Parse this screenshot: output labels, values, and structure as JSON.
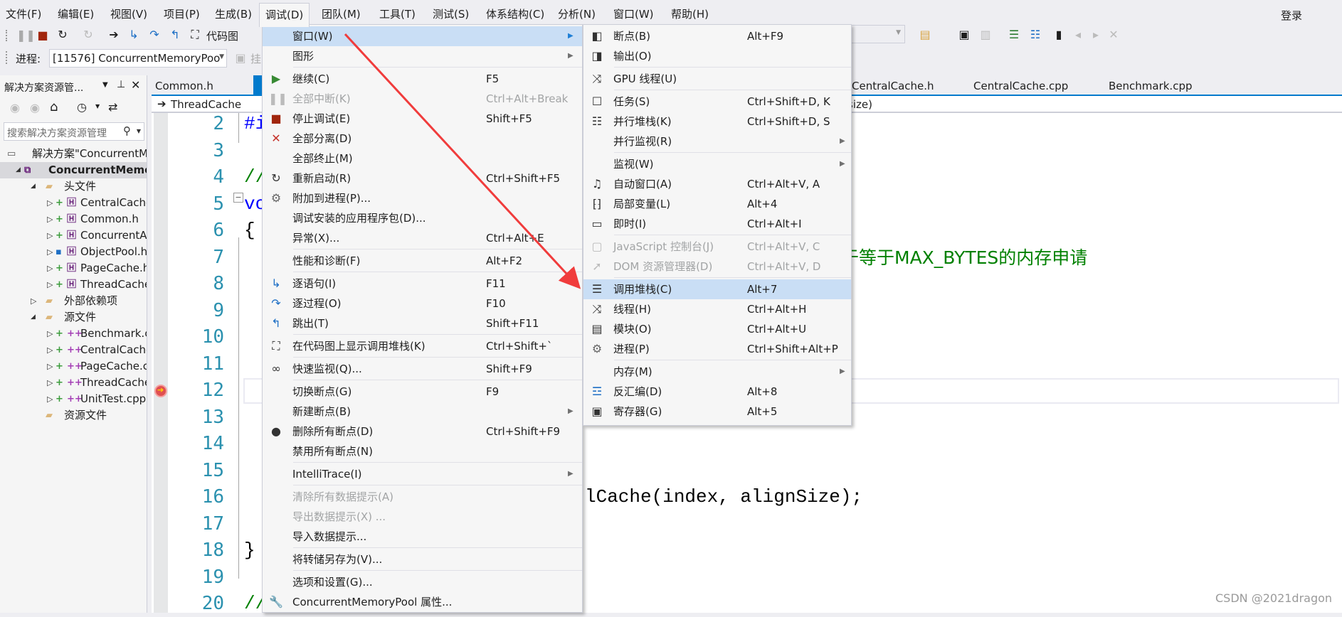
{
  "menubar": {
    "items": [
      "文件(F)",
      "编辑(E)",
      "视图(V)",
      "项目(P)",
      "生成(B)",
      "调试(D)",
      "团队(M)",
      "工具(T)",
      "测试(S)",
      "体系结构(C)",
      "分析(N)",
      "窗口(W)",
      "帮助(H)"
    ],
    "open_item": "调试(D)",
    "login": "登录"
  },
  "toolbar": {
    "code_map_label": "代码图",
    "process_label": "进程:",
    "process_value": "[11576] ConcurrentMemoryPoo",
    "suspend_label": "挂"
  },
  "solution_explorer": {
    "title": "解决方案资源管...",
    "search_placeholder": "搜索解决方案资源管理",
    "tree": [
      {
        "label": "解决方案\"ConcurrentM",
        "level": 0,
        "kind": "solution"
      },
      {
        "label": "ConcurrentMemor",
        "level": 1,
        "kind": "project",
        "selected": true
      },
      {
        "label": "头文件",
        "level": 2,
        "kind": "folder",
        "expanded": true
      },
      {
        "label": "CentralCache",
        "level": 3,
        "kind": "header"
      },
      {
        "label": "Common.h",
        "level": 3,
        "kind": "header"
      },
      {
        "label": "ConcurrentA",
        "level": 3,
        "kind": "header"
      },
      {
        "label": "ObjectPool.h",
        "level": 3,
        "kind": "header-locked"
      },
      {
        "label": "PageCache.h",
        "level": 3,
        "kind": "header"
      },
      {
        "label": "ThreadCache",
        "level": 3,
        "kind": "header"
      },
      {
        "label": "外部依赖项",
        "level": 2,
        "kind": "ext-folder",
        "expanded": false
      },
      {
        "label": "源文件",
        "level": 2,
        "kind": "folder",
        "expanded": true
      },
      {
        "label": "Benchmark.c",
        "level": 3,
        "kind": "source"
      },
      {
        "label": "CentralCache",
        "level": 3,
        "kind": "source"
      },
      {
        "label": "PageCache.c",
        "level": 3,
        "kind": "source"
      },
      {
        "label": "ThreadCache",
        "level": 3,
        "kind": "source"
      },
      {
        "label": "UnitTest.cpp",
        "level": 3,
        "kind": "source"
      },
      {
        "label": "资源文件",
        "level": 2,
        "kind": "folder-noexp"
      }
    ]
  },
  "editor": {
    "tabs": [
      "Common.h",
      "CentralCache.h",
      "CentralCache.cpp",
      "Benchmark.cpp"
    ],
    "nav_scope": "ThreadCache",
    "nav_member_fragment": "size)",
    "line_numbers": [
      2,
      3,
      4,
      5,
      6,
      7,
      8,
      9,
      10,
      11,
      12,
      13,
      14,
      15,
      16,
      17,
      18,
      19,
      20
    ],
    "current_line": 12,
    "code_fragments": [
      {
        "line": 2,
        "text": "#i",
        "color": "#0000ff"
      },
      {
        "line": 4,
        "text": "//",
        "color": "#008000"
      },
      {
        "line": 5,
        "text": "vo",
        "color": "#0000ff"
      },
      {
        "line": 6,
        "text": "{",
        "color": "#000000"
      },
      {
        "line": 7,
        "text": "于等于MAX_BYTES的内存申请",
        "color": "#008000"
      },
      {
        "line": 16,
        "text": "lCache(index, alignSize);",
        "color": "#000000"
      },
      {
        "line": 18,
        "text": "}",
        "color": "#000000"
      },
      {
        "line": 20,
        "text": "//",
        "color": "#008000"
      }
    ]
  },
  "debug_menu": {
    "items": [
      {
        "icon": "",
        "label": "窗口(W)",
        "shortcut": "",
        "submenu": true,
        "highlighted": true
      },
      {
        "icon": "",
        "label": "图形",
        "shortcut": "",
        "submenu": true
      },
      {
        "sep": true
      },
      {
        "icon": "continue-icon",
        "label": "继续(C)",
        "shortcut": "F5"
      },
      {
        "icon": "break-all-icon",
        "label": "全部中断(K)",
        "shortcut": "Ctrl+Alt+Break",
        "disabled": true
      },
      {
        "icon": "stop-icon",
        "label": "停止调试(E)",
        "shortcut": "Shift+F5"
      },
      {
        "icon": "detach-icon",
        "label": "全部分离(D)",
        "shortcut": ""
      },
      {
        "icon": "",
        "label": "全部终止(M)",
        "shortcut": ""
      },
      {
        "icon": "restart-icon",
        "label": "重新启动(R)",
        "shortcut": "Ctrl+Shift+F5"
      },
      {
        "icon": "attach-gears-icon",
        "label": "附加到进程(P)...",
        "shortcut": ""
      },
      {
        "icon": "",
        "label": "调试安装的应用程序包(D)...",
        "shortcut": ""
      },
      {
        "icon": "",
        "label": "异常(X)...",
        "shortcut": "Ctrl+Alt+E"
      },
      {
        "sep": true
      },
      {
        "icon": "",
        "label": "性能和诊断(F)",
        "shortcut": "Alt+F2"
      },
      {
        "sep": true
      },
      {
        "icon": "step-into-icon",
        "label": "逐语句(I)",
        "shortcut": "F11"
      },
      {
        "icon": "step-over-icon",
        "label": "逐过程(O)",
        "shortcut": "F10"
      },
      {
        "icon": "step-out-icon",
        "label": "跳出(T)",
        "shortcut": "Shift+F11"
      },
      {
        "sep": true
      },
      {
        "icon": "code-map-icon",
        "label": "在代码图上显示调用堆栈(K)",
        "shortcut": "Ctrl+Shift+`"
      },
      {
        "sep": true
      },
      {
        "icon": "quickwatch-glasses-icon",
        "label": "快速监视(Q)...",
        "shortcut": "Shift+F9"
      },
      {
        "sep": true
      },
      {
        "icon": "",
        "label": "切换断点(G)",
        "shortcut": "F9"
      },
      {
        "icon": "",
        "label": "新建断点(B)",
        "shortcut": "",
        "submenu": true
      },
      {
        "icon": "delete-breakpoints-icon",
        "label": "删除所有断点(D)",
        "shortcut": "Ctrl+Shift+F9"
      },
      {
        "icon": "",
        "label": "禁用所有断点(N)",
        "shortcut": ""
      },
      {
        "sep": true
      },
      {
        "icon": "",
        "label": "IntelliTrace(I)",
        "shortcut": "",
        "submenu": true
      },
      {
        "sep": true
      },
      {
        "icon": "",
        "label": "清除所有数据提示(A)",
        "shortcut": "",
        "disabled": true
      },
      {
        "icon": "",
        "label": "导出数据提示(X) ...",
        "shortcut": "",
        "disabled": true
      },
      {
        "icon": "",
        "label": "导入数据提示...",
        "shortcut": ""
      },
      {
        "sep": true
      },
      {
        "icon": "",
        "label": "将转储另存为(V)...",
        "shortcut": ""
      },
      {
        "sep": true
      },
      {
        "icon": "",
        "label": "选项和设置(G)...",
        "shortcut": ""
      },
      {
        "icon": "wrench-icon",
        "label": "ConcurrentMemoryPool 属性...",
        "shortcut": ""
      }
    ]
  },
  "window_submenu": {
    "items": [
      {
        "icon": "breakpoints-icon",
        "label": "断点(B)",
        "shortcut": "Alt+F9"
      },
      {
        "icon": "output-icon",
        "label": "输出(O)",
        "shortcut": ""
      },
      {
        "sep": true
      },
      {
        "icon": "gpu-threads-icon",
        "label": "GPU 线程(U)",
        "shortcut": ""
      },
      {
        "sep": true
      },
      {
        "icon": "tasks-icon",
        "label": "任务(S)",
        "shortcut": "Ctrl+Shift+D, K"
      },
      {
        "icon": "parallel-stacks-icon",
        "label": "并行堆栈(K)",
        "shortcut": "Ctrl+Shift+D, S"
      },
      {
        "icon": "",
        "label": "并行监视(R)",
        "shortcut": "",
        "submenu": true
      },
      {
        "sep": true
      },
      {
        "icon": "",
        "label": "监视(W)",
        "shortcut": "",
        "submenu": true
      },
      {
        "icon": "autos-icon",
        "label": "自动窗口(A)",
        "shortcut": "Ctrl+Alt+V, A"
      },
      {
        "icon": "locals-icon",
        "label": "局部变量(L)",
        "shortcut": "Alt+4"
      },
      {
        "icon": "immediate-icon",
        "label": "即时(I)",
        "shortcut": "Ctrl+Alt+I"
      },
      {
        "sep": true
      },
      {
        "icon": "js-console-icon",
        "label": "JavaScript 控制台(J)",
        "shortcut": "Ctrl+Alt+V, C",
        "disabled": true
      },
      {
        "icon": "dom-explorer-icon",
        "label": "DOM 资源管理器(D)",
        "shortcut": "Ctrl+Alt+V, D",
        "disabled": true
      },
      {
        "sep": true
      },
      {
        "icon": "call-stack-icon",
        "label": "调用堆栈(C)",
        "shortcut": "Alt+7",
        "highlighted": true
      },
      {
        "icon": "threads-icon",
        "label": "线程(H)",
        "shortcut": "Ctrl+Alt+H"
      },
      {
        "icon": "modules-icon",
        "label": "模块(O)",
        "shortcut": "Ctrl+Alt+U"
      },
      {
        "icon": "processes-icon",
        "label": "进程(P)",
        "shortcut": "Ctrl+Shift+Alt+P"
      },
      {
        "sep": true
      },
      {
        "icon": "",
        "label": "内存(M)",
        "shortcut": "",
        "submenu": true
      },
      {
        "icon": "disassembly-icon",
        "label": "反汇编(D)",
        "shortcut": "Alt+8"
      },
      {
        "icon": "registers-icon",
        "label": "寄存器(G)",
        "shortcut": "Alt+5"
      }
    ]
  },
  "annotation": {
    "arrow_color": "#f03c3c"
  },
  "watermark": "CSDN @2021dragon",
  "colors": {
    "accent": "#007acc",
    "menu_highlight": "#c9def5",
    "line_number": "#2b91af"
  }
}
